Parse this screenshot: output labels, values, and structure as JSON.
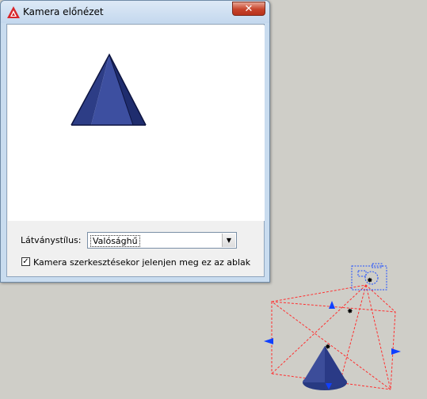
{
  "window": {
    "title": "Kamera előnézet",
    "close_label": "✕"
  },
  "controls": {
    "visual_style_label": "Látványstílus:",
    "visual_style_value": "Valósághű",
    "show_on_edit_label": "Kamera szerkesztésekor jelenjen meg ez az ablak",
    "show_on_edit_checked": true,
    "check_mark": "✓",
    "dropdown_arrow": "▼"
  },
  "colors": {
    "cone_body": "#3c4d9a",
    "cone_shadow": "#283a82",
    "frustum_lines": "#ff3030",
    "grip": "#1040ff",
    "camera_glyph": "#2050ff"
  },
  "icons": {
    "app": "autocad-logo-icon",
    "close": "close-icon",
    "dropdown": "chevron-down-icon",
    "camera": "camera-icon"
  }
}
